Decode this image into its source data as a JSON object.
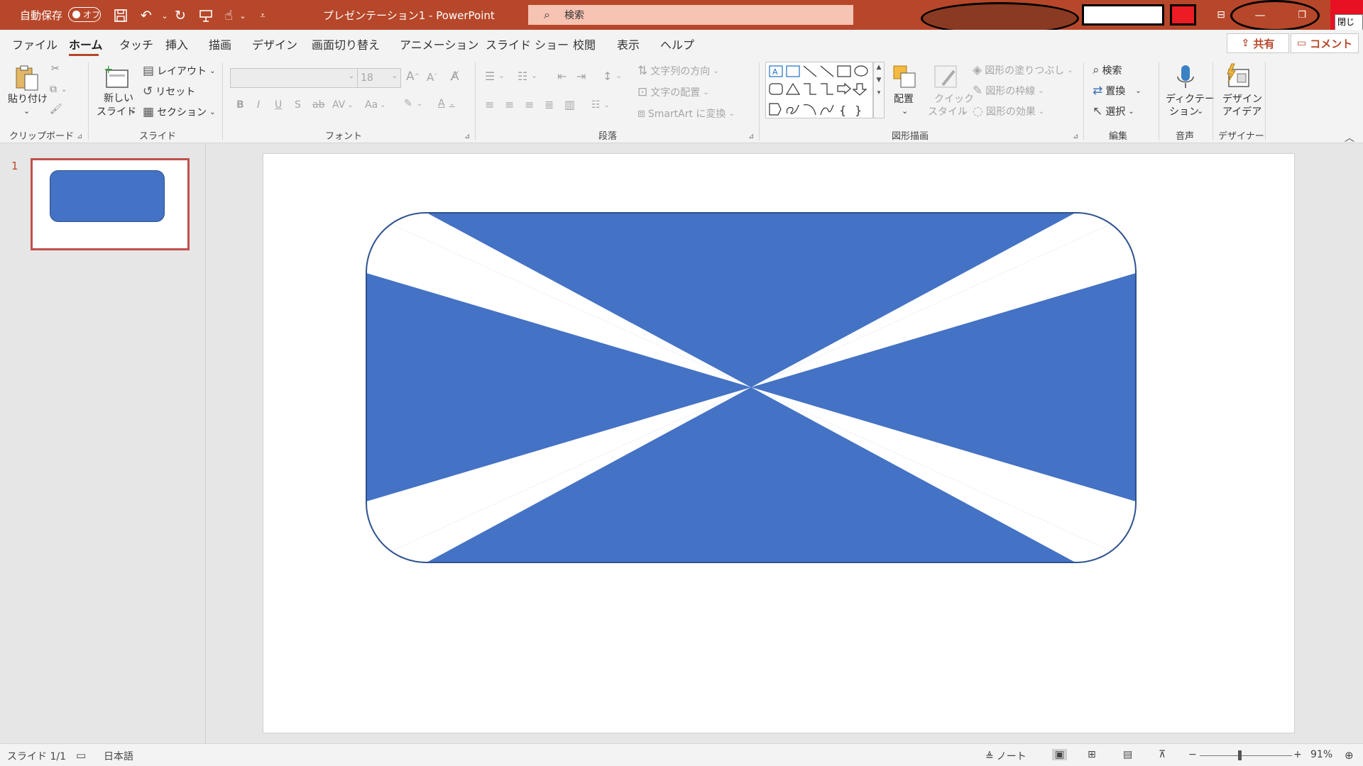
{
  "titlebar": {
    "autosave_label": "自動保存",
    "autosave_state": "オフ",
    "doc_title": "プレゼンテーション1 - PowerPoint",
    "search_placeholder": "検索",
    "close_tooltip": "閉じる",
    "colors": {
      "bar": "#b7472a",
      "search": "#f7c3b3",
      "close": "#e81123"
    },
    "quick_access_icons": [
      "save-icon",
      "undo-icon",
      "redo-icon",
      "present-from-start-icon",
      "touch-mode-icon",
      "customize-icon"
    ]
  },
  "tabs": {
    "items": [
      "ファイル",
      "ホーム",
      "タッチ",
      "挿入",
      "描画",
      "デザイン",
      "画面切り替え",
      "アニメーション",
      "スライド ショー",
      "校閲",
      "表示",
      "ヘルプ"
    ],
    "active": "ホーム",
    "share": "共有",
    "comment": "コメント"
  },
  "ribbon": {
    "clipboard": {
      "paste": "貼り付け",
      "label": "クリップボード"
    },
    "slides": {
      "new_slide_line1": "新しい",
      "new_slide_line2": "スライド",
      "layout": "レイアウト",
      "reset": "リセット",
      "section": "セクション",
      "label": "スライド"
    },
    "font": {
      "size": "18",
      "bold": "B",
      "italic": "I",
      "underline": "U",
      "shadow": "S",
      "strike": "ab",
      "spacing": "AV",
      "case": "Aa",
      "grow": "A",
      "shrink": "A",
      "color": "A",
      "label": "フォント"
    },
    "paragraph": {
      "direction": "文字列の方向",
      "align_text": "文字の配置",
      "smartart": "SmartArt に変換",
      "label": "段落"
    },
    "drawing": {
      "arrange": "配置",
      "quick_style_line1": "クイック",
      "quick_style_line2": "スタイル",
      "fill": "図形の塗りつぶし",
      "outline": "図形の枠線",
      "effects": "図形の効果",
      "label": "図形描画"
    },
    "editing": {
      "find": "検索",
      "replace": "置換",
      "select": "選択",
      "label": "編集"
    },
    "voice": {
      "dictate_line1": "ディクテー",
      "dictate_line2": "ション",
      "label": "音声"
    },
    "designer": {
      "ideas_line1": "デザイン",
      "ideas_line2": "アイデア",
      "label": "デザイナー"
    }
  },
  "thumbnails": [
    {
      "number": "1"
    }
  ],
  "slide": {
    "fill_color": "#4472c4",
    "outline_color": "#2f528f"
  },
  "statusbar": {
    "slide_counter": "スライド 1/1",
    "language": "日本語",
    "notes": "ノート",
    "zoom": "91%",
    "zoom_minus": "−",
    "zoom_plus": "+"
  }
}
